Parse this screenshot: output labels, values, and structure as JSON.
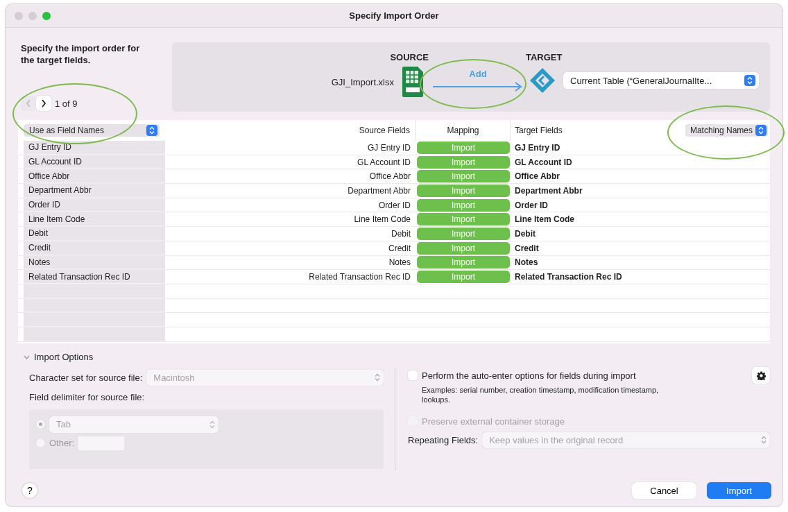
{
  "window": {
    "title": "Specify Import Order",
    "buttons": [
      {
        "kind": "close",
        "active": false
      },
      {
        "kind": "minimize",
        "active": false
      },
      {
        "kind": "zoom",
        "active": true
      }
    ]
  },
  "instructions": "Specify the import order for the target fields.",
  "pager": {
    "text": "1 of 9",
    "prev_disabled": true,
    "next_disabled": false
  },
  "source": {
    "heading": "SOURCE",
    "file": "GJI_Import.xlsx"
  },
  "mapping_action": "Add",
  "target": {
    "heading": "TARGET",
    "table": "Current Table (“GeneralJournalIte..."
  },
  "row_option": "Use as Field Names",
  "columns": [
    "Source Fields",
    "Mapping",
    "Target Fields"
  ],
  "match_option": "Matching Names",
  "rows": [
    {
      "first_row": "GJ Entry ID",
      "source": "GJ Entry ID",
      "mapping": "Import",
      "target": "GJ Entry ID"
    },
    {
      "first_row": "GL Account ID",
      "source": "GL Account ID",
      "mapping": "Import",
      "target": "GL Account ID"
    },
    {
      "first_row": "Office Abbr",
      "source": "Office Abbr",
      "mapping": "Import",
      "target": "Office Abbr"
    },
    {
      "first_row": "Department Abbr",
      "source": "Department Abbr",
      "mapping": "Import",
      "target": "Department Abbr"
    },
    {
      "first_row": "Order ID",
      "source": "Order ID",
      "mapping": "Import",
      "target": "Order ID"
    },
    {
      "first_row": "Line Item Code",
      "source": "Line Item Code",
      "mapping": "Import",
      "target": "Line Item Code"
    },
    {
      "first_row": "Debit",
      "source": "Debit",
      "mapping": "Import",
      "target": "Debit"
    },
    {
      "first_row": "Credit",
      "source": "Credit",
      "mapping": "Import",
      "target": "Credit"
    },
    {
      "first_row": "Notes",
      "source": "Notes",
      "mapping": "Import",
      "target": "Notes"
    },
    {
      "first_row": "Related Transaction Rec ID",
      "source": "Related Transaction Rec ID",
      "mapping": "Import",
      "target": "Related Transaction Rec ID"
    }
  ],
  "import_options": {
    "label": "Import Options",
    "expanded": true,
    "charset_label": "Character set for source file:",
    "charset": "Macintosh",
    "charset_disabled": true,
    "delimiter_label": "Field delimiter for source file:",
    "delimiters_disabled": true,
    "delimiters": [
      {
        "kind": "popup",
        "label": "Tab",
        "selected": true
      },
      {
        "kind": "field",
        "label": "Other:",
        "selected": false
      }
    ]
  },
  "auto_enter": {
    "label": "Perform the auto-enter options for fields during import",
    "checked": false,
    "note": "Examples: serial number, creation timestamp, modification timestamp, lookups."
  },
  "preserve": {
    "label": "Preserve external container storage",
    "checked": false,
    "disabled": true
  },
  "repeating": {
    "label": "Repeating Fields:",
    "value": "Keep values in the original record",
    "disabled": true
  },
  "help": "?",
  "buttons": [
    {
      "label": "Cancel",
      "default": false
    },
    {
      "label": "Import",
      "default": true
    }
  ]
}
